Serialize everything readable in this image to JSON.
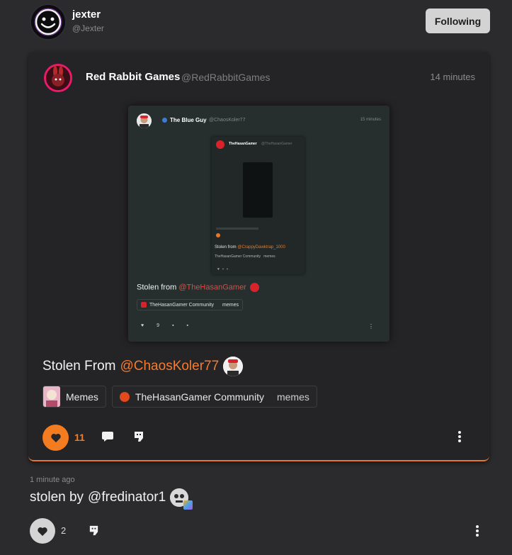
{
  "header": {
    "user_name": "jexter",
    "user_handle": "@Jexter",
    "follow_label": "Following"
  },
  "quoted_post": {
    "author_name": "Red Rabbit Games",
    "author_handle": "@RedRabbitGames",
    "time": "14 minutes",
    "screenshot": {
      "author_name": "The Blue Guy",
      "author_handle": "@ChaosKoler77",
      "time": "15 minutes",
      "inner_author": "TheHasanGamer",
      "inner_handle": "@TheHasanGamer",
      "inner_stolen_prefix": "Stolen from",
      "inner_stolen_mention": "@CrappyDawktrap_1000",
      "inner_community": "TheHasanGamer Community",
      "inner_tag": "memes",
      "stolen_prefix": "Stolen from",
      "stolen_mention": "@TheHasanGamer",
      "community": "TheHasanGamer Community",
      "tag": "memes",
      "like_count": "9"
    },
    "text_prefix": "Stolen From",
    "text_mention": "@ChaosKoler77",
    "chips": [
      {
        "label": "Memes"
      },
      {
        "label": "TheHasanGamer Community",
        "tag": "memes"
      }
    ],
    "like_count": "11",
    "accent_color": "#f47c20"
  },
  "post": {
    "time": "1 minute ago",
    "text_prefix": "stolen by",
    "text_mention": "@fredinator1",
    "like_count": "2"
  },
  "icons": {
    "like": "heart-icon",
    "comment": "comment-icon",
    "repost": "repost-icon",
    "more": "more-vertical-icon"
  }
}
